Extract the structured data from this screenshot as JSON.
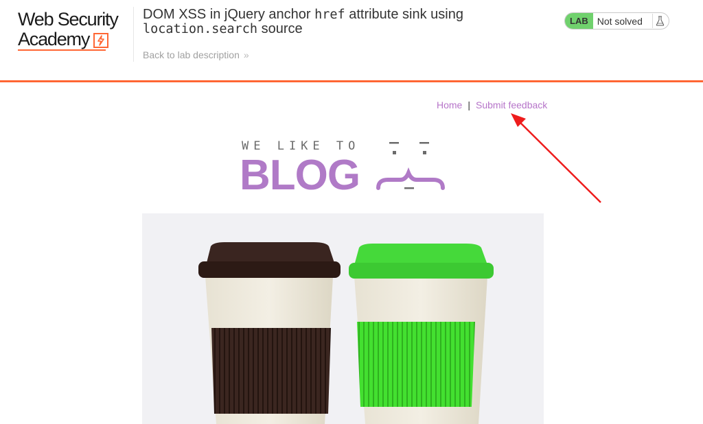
{
  "header": {
    "logo": {
      "line1": "Web Security",
      "line2": "Academy"
    },
    "lab_title_prefix": "DOM XSS in jQuery anchor ",
    "lab_title_code1": "href",
    "lab_title_mid": " attribute sink using ",
    "lab_title_code2": "location.search",
    "lab_title_suffix": " source",
    "back_link": "Back to lab description",
    "status": {
      "badge": "LAB",
      "state": "Not solved",
      "icon": "flask-icon"
    }
  },
  "nav": {
    "home": "Home",
    "separator": "|",
    "feedback": "Submit feedback"
  },
  "banner": {
    "tagline": "WE LIKE TO",
    "word": "BLOG"
  },
  "colors": {
    "accent_orange": "#ff6633",
    "lab_green": "#70d16d",
    "link_purple": "#b674c9",
    "blog_purple": "#b07ac7",
    "annotation_red": "#ee1c1c"
  },
  "hero": {
    "icon": "coffee-cups-image"
  }
}
